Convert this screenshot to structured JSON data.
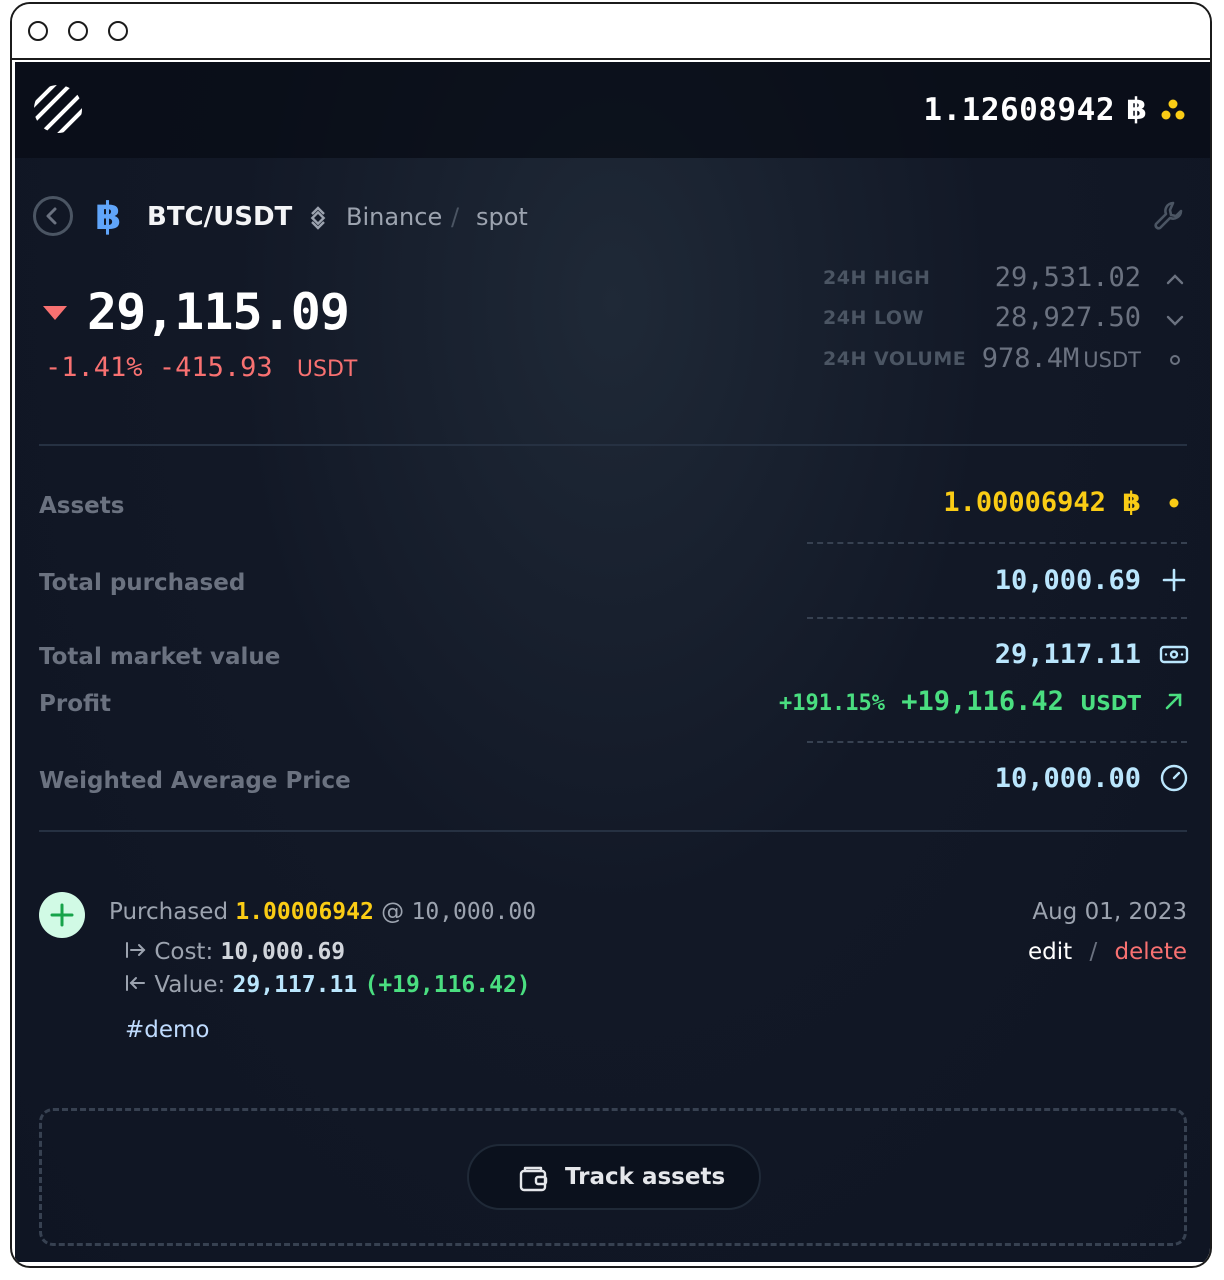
{
  "header": {
    "balance": "1.12608942",
    "balance_symbol": "฿"
  },
  "pair": {
    "symbol_icon": "฿",
    "name": "BTC/USDT",
    "exchange": "Binance",
    "separator": "/",
    "market": "spot"
  },
  "ticker": {
    "price": "29,115.09",
    "change_percent": "-1.41%",
    "change_value": "-415.93",
    "change_unit": "USDT",
    "high_label": "24H HIGH",
    "high_value": "29,531.02",
    "low_label": "24H LOW",
    "low_value": "28,927.50",
    "volume_label": "24H VOLUME",
    "volume_value": "978.4M",
    "volume_unit": "USDT"
  },
  "assets": {
    "assets_label": "Assets",
    "assets_value": "1.00006942",
    "assets_symbol": "฿",
    "purchased_label": "Total purchased",
    "purchased_value": "10,000.69",
    "market_value_label": "Total market value",
    "market_value": "29,117.11",
    "profit_label": "Profit",
    "profit_percent": "+191.15%",
    "profit_value": "+19,116.42",
    "profit_unit": "USDT",
    "wap_label": "Weighted Average Price",
    "wap_value": "10,000.00"
  },
  "transaction": {
    "prefix": "Purchased",
    "amount": "1.00006942",
    "at": "@",
    "price": "10,000.00",
    "cost_label": "Cost:",
    "cost_value": "10,000.69",
    "value_label": "Value:",
    "value_amount": "29,117.11",
    "value_gain": "(+19,116.42)",
    "tag": "#demo",
    "date": "Aug 01, 2023",
    "edit": "edit",
    "action_separator": "/",
    "delete": "delete"
  },
  "track": {
    "button_label": "Track assets"
  },
  "colors": {
    "accent_yellow": "#facc15",
    "accent_blue": "#bae6fd",
    "positive": "#4ade80",
    "negative": "#f87171"
  }
}
